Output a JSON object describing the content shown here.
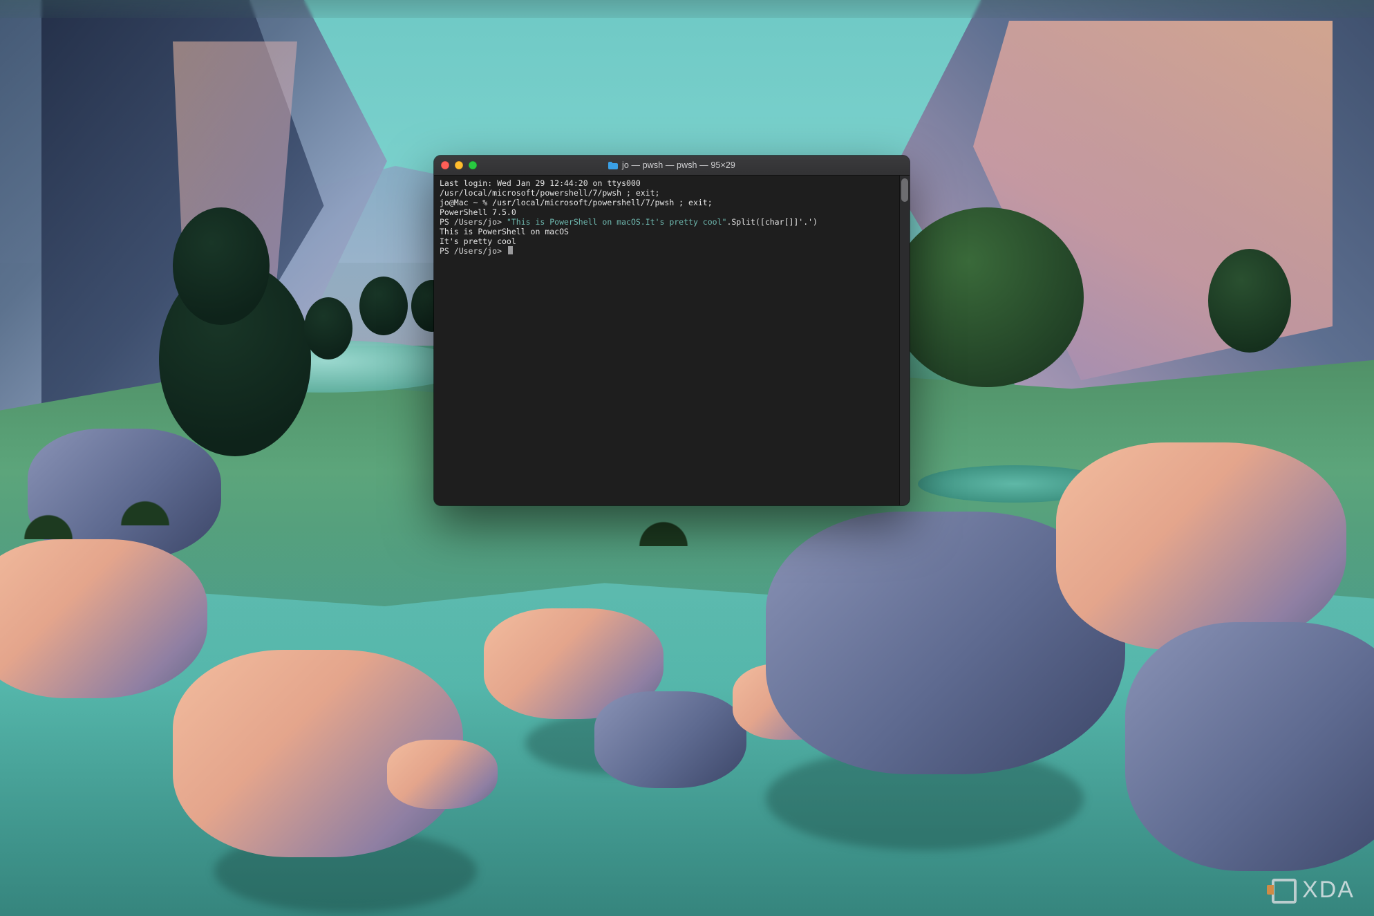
{
  "window": {
    "title": "jo — pwsh — pwsh — 95×29",
    "cols": 95,
    "rows": 29
  },
  "traffic_lights": {
    "close": "close",
    "minimize": "minimize",
    "zoom": "zoom"
  },
  "terminal": {
    "lines": {
      "l0": "Last login: Wed Jan 29 12:44:20 on ttys000",
      "l1": "/usr/local/microsoft/powershell/7/pwsh ; exit;",
      "l2": "jo@Mac ~ % /usr/local/microsoft/powershell/7/pwsh ; exit;",
      "l3": "PowerShell 7.5.0",
      "l4_prompt": "PS /Users/jo> ",
      "l4_string": "\"This is PowerShell on macOS.It's pretty cool\"",
      "l4_tail": ".Split([char[]]'.')",
      "l5": "This is PowerShell on macOS",
      "l6": "It's pretty cool",
      "l7_prompt": "PS /Users/jo>"
    }
  },
  "watermark": {
    "text": "XDA"
  }
}
